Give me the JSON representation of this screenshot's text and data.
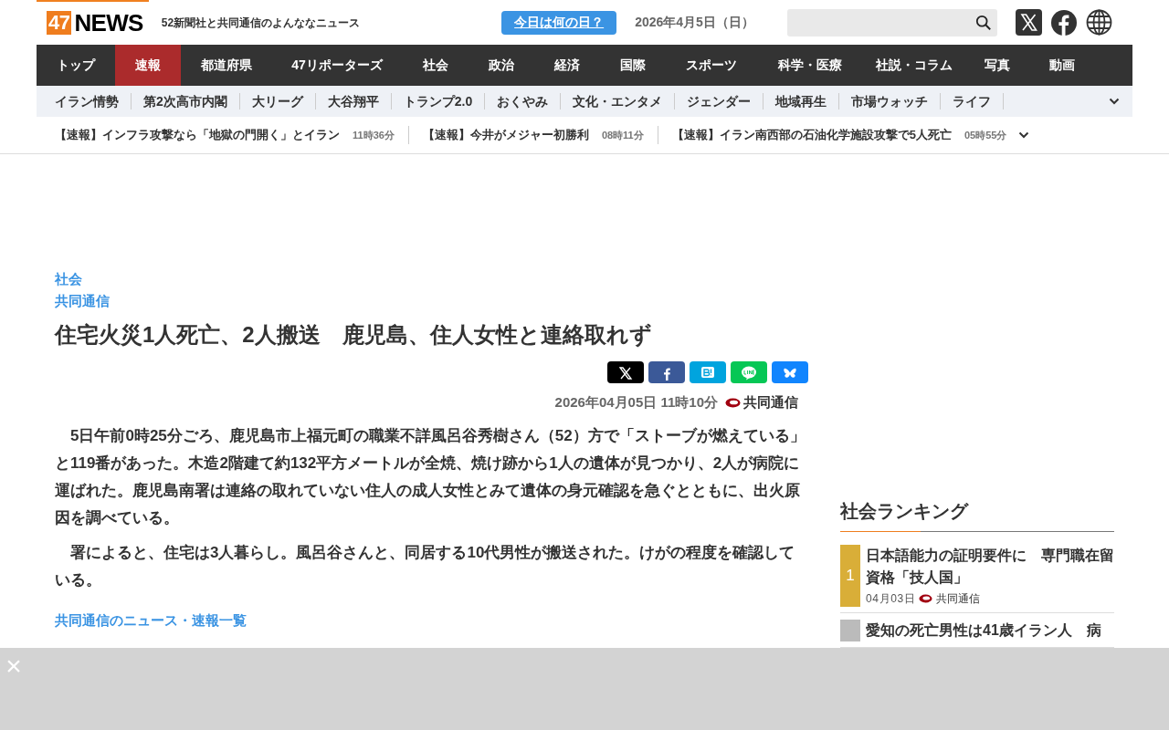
{
  "header": {
    "logo_number": "47",
    "logo_text": "NEWS",
    "tagline": "52新聞社と共同通信のよんななニュース",
    "today_button": "今日は何の日？",
    "date": "2026年4月5日（日）"
  },
  "nav": [
    {
      "label": "トップ",
      "selected": false
    },
    {
      "label": "速報",
      "selected": true
    },
    {
      "label": "都道府県",
      "selected": false
    },
    {
      "label": "47リポーターズ",
      "selected": false
    },
    {
      "label": "社会",
      "selected": false
    },
    {
      "label": "政治",
      "selected": false
    },
    {
      "label": "経済",
      "selected": false
    },
    {
      "label": "国際",
      "selected": false
    },
    {
      "label": "スポーツ",
      "selected": false
    },
    {
      "label": "科学・医療",
      "selected": false
    },
    {
      "label": "社説・コラム",
      "selected": false
    },
    {
      "label": "写真",
      "selected": false
    },
    {
      "label": "動画",
      "selected": false
    }
  ],
  "topics": [
    "イラン情勢",
    "第2次高市内閣",
    "大リーグ",
    "大谷翔平",
    "トランプ2.0",
    "おくやみ",
    "文化・エンタメ",
    "ジェンダー",
    "地域再生",
    "市場ウォッチ",
    "ライフ"
  ],
  "ticker": [
    {
      "title": "【速報】インフラ攻撃なら「地獄の門開く」とイラン",
      "time": "11時36分"
    },
    {
      "title": "【速報】今井がメジャー初勝利",
      "time": "08時11分"
    },
    {
      "title": "【速報】イラン南西部の石油化学施設攻撃で5人死亡",
      "time": "05時55分"
    }
  ],
  "article": {
    "category": "社会",
    "source": "共同通信",
    "title": "住宅火災1人死亡、2人搬送　鹿児島、住人女性と連絡取れず",
    "datetime": "2026年04月05日 11時10分",
    "byline": "共同通信",
    "paragraphs": [
      "　5日午前0時25分ごろ、鹿児島市上福元町の職業不詳風呂谷秀樹さん（52）方で「ストーブが燃えている」と119番があった。木造2階建て約132平方メートルが全焼、焼け跡から1人の遺体が見つかり、2人が病院に運ばれた。鹿児島南署は連絡の取れていない住人の成人女性とみて遺体の身元確認を急ぐとともに、出火原因を調べている。",
      "　署によると、住宅は3人暮らし。風呂谷さんと、同居する10代男性が搬送された。けがの程度を確認している。"
    ],
    "list_link": "共同通信のニュース・速報一覧"
  },
  "ranking": {
    "title": "社会ランキング",
    "items": [
      {
        "rank": "1",
        "color": "#d9ae38",
        "title": "日本語能力の証明要件に　専門職在留資格「技人国」",
        "date": "04月03日",
        "source": "共同通信"
      },
      {
        "color": "#bbbbbb",
        "title": "愛知の死亡男性は41歳イラン人　病"
      }
    ]
  },
  "overlay": {
    "close": "×"
  }
}
